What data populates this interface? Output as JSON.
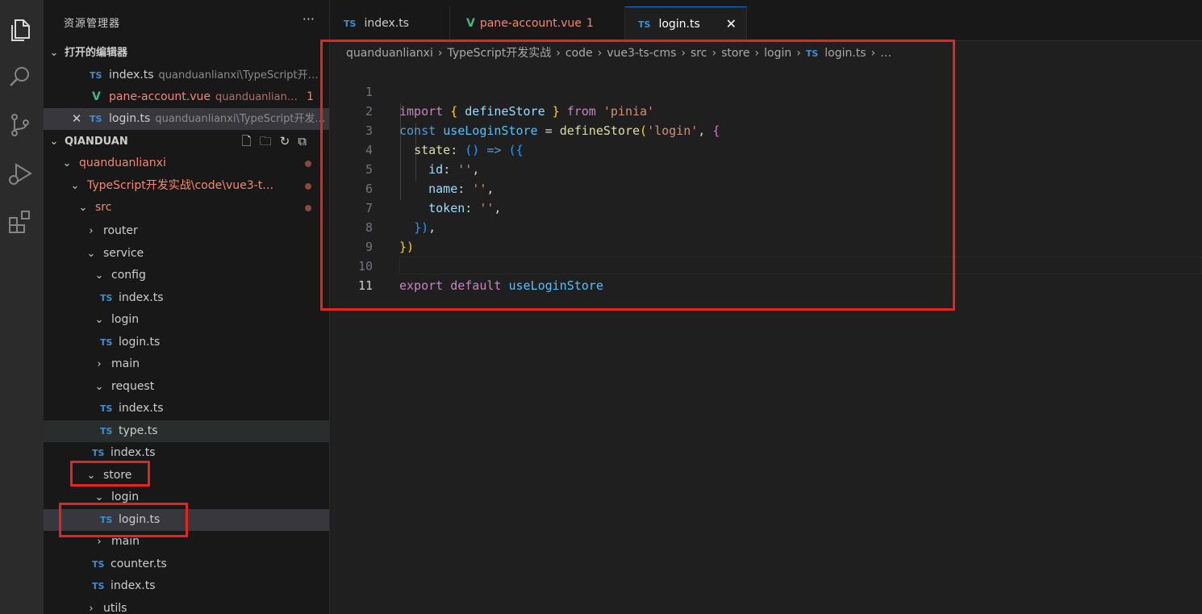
{
  "activity_bar": {
    "icons": [
      "explorer-icon",
      "search-icon",
      "source-control-icon",
      "run-debug-icon",
      "extensions-icon"
    ]
  },
  "sidebar": {
    "title": "资源管理器",
    "more": "···",
    "open_editors_header": "打开的编辑器",
    "open_editors": [
      {
        "name": "index.ts",
        "desc": "quanduanlianxi\\TypeScript开…"
      },
      {
        "name": "pane-account.vue",
        "desc": "quanduanlian…",
        "badge": "1"
      },
      {
        "name": "login.ts",
        "desc": "quanduanlianxi\\TypeScript开发…"
      }
    ],
    "workspace_header": "QIANDUAN",
    "tree": {
      "root": "quanduanlianxi",
      "path": "TypeScript开发实战\\code\\vue3-t…",
      "src": "src",
      "router": "router",
      "service": "service",
      "config": "config",
      "config_index": "index.ts",
      "login": "login",
      "login_file": "login.ts",
      "main": "main",
      "request": "request",
      "request_index": "index.ts",
      "request_type": "type.ts",
      "service_index": "index.ts",
      "store": "store",
      "store_login": "login",
      "store_login_file": "login.ts",
      "store_main": "main",
      "counter": "counter.ts",
      "store_index": "index.ts",
      "utils": "utils"
    }
  },
  "tabs": [
    {
      "label": "index.ts"
    },
    {
      "label": "pane-account.vue",
      "badge": "1"
    },
    {
      "label": "login.ts",
      "close": "✕"
    }
  ],
  "breadcrumb": [
    "quanduanlianxi",
    "TypeScript开发实战",
    "code",
    "vue3-ts-cms",
    "src",
    "store",
    "login",
    "login.ts",
    "…"
  ],
  "code": {
    "line_numbers": [
      "1",
      "2",
      "3",
      "4",
      "5",
      "6",
      "7",
      "8",
      "9",
      "10",
      "11"
    ],
    "l1": {
      "a": "import",
      "b": "{",
      "c": "defineStore",
      "d": "}",
      "e": "from",
      "f": "'pinia'"
    },
    "l2": {
      "a": "const",
      "b": "useLoginStore",
      "c": "=",
      "d": "defineStore",
      "e": "(",
      "f": "'login'",
      "g": ",",
      "h": "{"
    },
    "l3": {
      "a": "state",
      "b": ":",
      "c": "()",
      "d": "=>",
      "e": "({"
    },
    "l4": {
      "a": "id",
      "b": ":",
      "c": "''",
      "d": ","
    },
    "l5": {
      "a": "name",
      "b": ":",
      "c": "''",
      "d": ","
    },
    "l6": {
      "a": "token",
      "b": ":",
      "c": "''",
      "d": ","
    },
    "l7": {
      "a": "})",
      "b": ","
    },
    "l8": {
      "a": "})"
    },
    "l10": {
      "a": "export",
      "b": "default",
      "c": "useLoginStore"
    }
  }
}
